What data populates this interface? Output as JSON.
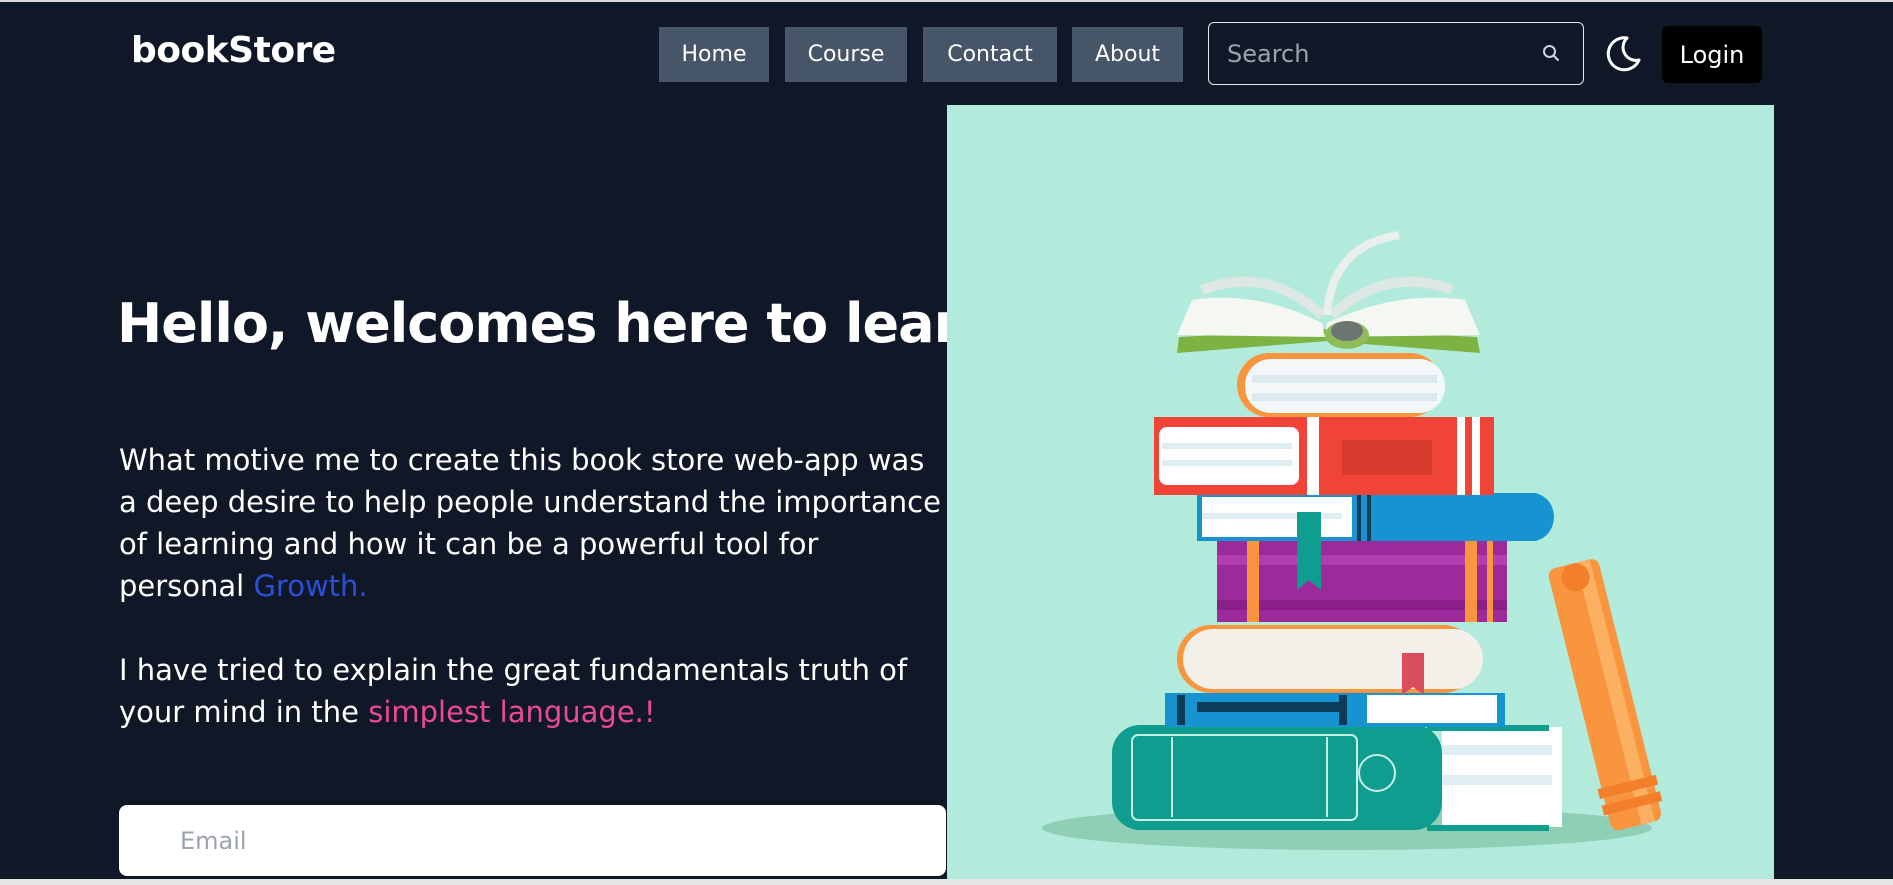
{
  "navbar": {
    "brand": "bookStore",
    "links": [
      "Home",
      "Course",
      "Contact",
      "About"
    ],
    "search": {
      "placeholder": "Search",
      "value": ""
    },
    "theme_icon": "moon-icon",
    "search_icon": "search-icon",
    "login_label": "Login"
  },
  "hero": {
    "title": "Hello, welcomes here to learn something new everyday!!!",
    "paragraph1_text": "What motive me to create this book store web-app was a deep desire to help people understand the importance of learning and how it can be a powerful tool for personal ",
    "paragraph1_highlight": "Growth.",
    "paragraph2_text": "I have tried to explain the great fundamentals truth of your mind in the ",
    "paragraph2_highlight": "simplest language.!",
    "email": {
      "placeholder": "Email",
      "value": ""
    }
  },
  "illustration": {
    "icon": "stack-of-books-illustration",
    "background": "#b2ebdc"
  },
  "colors": {
    "background": "#101828",
    "nav_button": "#475569",
    "accent_blue": "#2b4fd6",
    "accent_pink": "#ec4899",
    "login_button": "#000000"
  }
}
